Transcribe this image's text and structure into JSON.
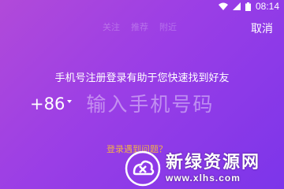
{
  "status_bar": {
    "time": "08:14",
    "icons": [
      "wifi-icon",
      "signal-icon",
      "battery-icon"
    ]
  },
  "tabs": [
    "关注",
    "推荐",
    "附近"
  ],
  "cancel_label": "取消",
  "hint": "手机号注册登录有助于您快速找到好友",
  "phone": {
    "country_code": "+86",
    "placeholder": "输入手机号码",
    "value": ""
  },
  "problem_link": "登录遇到问题？",
  "watermark": {
    "title": "新绿资源网",
    "url": "www.xlhs.com"
  },
  "colors": {
    "gradient_start": "#b14ad9",
    "gradient_end": "#7c35ea",
    "link": "#f1b04a"
  }
}
